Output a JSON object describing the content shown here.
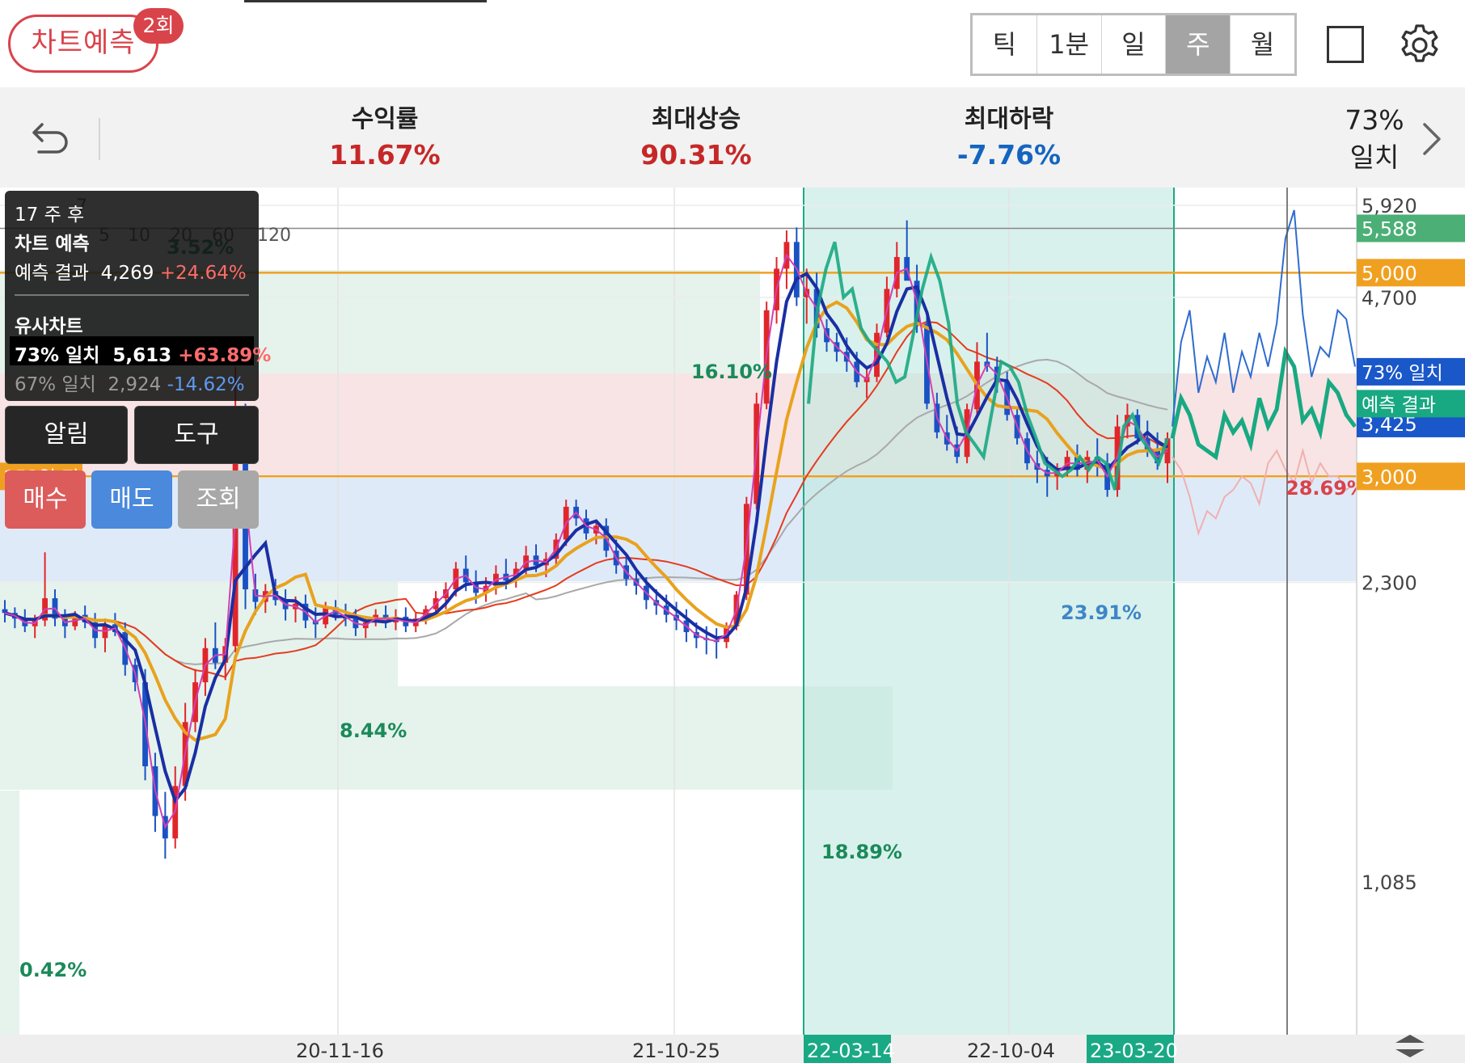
{
  "header": {
    "title_pill": "차트예측",
    "badge": "2회",
    "periods": [
      {
        "label": "틱",
        "active": false
      },
      {
        "label": "1분",
        "active": false
      },
      {
        "label": "일",
        "active": false
      },
      {
        "label": "주",
        "active": true
      },
      {
        "label": "월",
        "active": false
      }
    ]
  },
  "stats": {
    "return": {
      "label": "수익률",
      "value": "11.67%",
      "color": "#c62828"
    },
    "max_rise": {
      "label": "최대상승",
      "value": "90.31%",
      "color": "#c62828"
    },
    "max_fall": {
      "label": "최대하락",
      "value": "-7.76%",
      "color": "#1565c0"
    },
    "match_pct": "73%",
    "match_label": "일치"
  },
  "overlay": {
    "weeks_after": "17 주 후",
    "prediction_title": "차트 예측",
    "prediction_label": "예측 결과",
    "prediction_value": "4,269",
    "prediction_change": "+24.64%",
    "similar_title": "유사차트",
    "match1_label": "73% 일치",
    "match1_value": "5,613",
    "match1_change": "+63.89%",
    "match2_label": "67% 일치",
    "match2_value": "2,924",
    "match2_change": "-14.62%"
  },
  "buttons": {
    "alert": "알림",
    "tools": "도구",
    "buy": "매수",
    "sell": "매도",
    "view": "조회"
  },
  "colors": {
    "accent": "#d9434a",
    "rise": "#e0262b",
    "fall": "#1a52c4",
    "ma5": "#d33fb4",
    "ma10": "#1a2fa3",
    "ma20": "#e8a21e",
    "ma60": "#e53b1e",
    "ma120": "#a9a9a9",
    "prediction": "#19a982",
    "match_line": "#2e6cd0",
    "level_line": "#f0a020"
  },
  "chart_data": {
    "type": "candlestick",
    "period": "weekly",
    "ylim": [
      1085,
      5920
    ],
    "y_ticks": [
      "5,920",
      "4,700",
      "2,300",
      "1,085"
    ],
    "x_ticks": [
      "20-11-16",
      "21-10-25",
      "22-10-04"
    ],
    "highlight_dates": [
      "22-03-14",
      "23-03-20"
    ],
    "ma_legend": [
      "5",
      "10",
      "20",
      "60",
      "120"
    ],
    "legend_prefix": "7",
    "price_labels": [
      {
        "text": "5,588",
        "value": 5588,
        "color": "#4caf76"
      },
      {
        "text": "5,000",
        "value": 5000,
        "color": "#f0a020"
      },
      {
        "text": "3,000",
        "value": 3000,
        "color": "#f0a020"
      },
      {
        "text": "3,425",
        "value": 3425,
        "color": "#1a57c9"
      }
    ],
    "line_labels": {
      "match": "73% 일치",
      "prediction": "예측 결과",
      "days_ago": "153일 전"
    },
    "annotations": [
      "16.10%",
      "8.44%",
      "18.89%",
      "0.42%",
      "28.69%",
      "23.91%",
      "3.52%"
    ],
    "candles": [
      [
        2150,
        2200,
        2080,
        2130
      ],
      [
        2130,
        2160,
        2050,
        2100
      ],
      [
        2100,
        2150,
        2030,
        2060
      ],
      [
        2060,
        2120,
        2000,
        2090
      ],
      [
        2090,
        2480,
        2060,
        2210
      ],
      [
        2210,
        2260,
        2060,
        2100
      ],
      [
        2100,
        2150,
        2000,
        2060
      ],
      [
        2060,
        2140,
        2040,
        2120
      ],
      [
        2120,
        2170,
        2050,
        2080
      ],
      [
        2080,
        2130,
        1950,
        2000
      ],
      [
        2000,
        2100,
        1930,
        2070
      ],
      [
        2070,
        2130,
        2010,
        2030
      ],
      [
        2030,
        2080,
        1820,
        1870
      ],
      [
        1870,
        1900,
        1750,
        1790
      ],
      [
        1790,
        1850,
        1400,
        1450
      ],
      [
        1450,
        1500,
        1230,
        1280
      ],
      [
        1280,
        1360,
        1150,
        1210
      ],
      [
        1210,
        1450,
        1180,
        1380
      ],
      [
        1380,
        1700,
        1330,
        1620
      ],
      [
        1620,
        1850,
        1580,
        1790
      ],
      [
        1790,
        2000,
        1730,
        1950
      ],
      [
        1950,
        2080,
        1850,
        1880
      ],
      [
        1880,
        2000,
        1800,
        1960
      ],
      [
        1960,
        3950,
        1930,
        3450
      ],
      [
        3450,
        3600,
        2150,
        2260
      ],
      [
        2260,
        2350,
        2120,
        2190
      ],
      [
        2190,
        2290,
        2130,
        2250
      ],
      [
        2250,
        2320,
        2170,
        2200
      ],
      [
        2200,
        2260,
        2090,
        2150
      ],
      [
        2150,
        2220,
        2080,
        2180
      ],
      [
        2180,
        2230,
        2050,
        2090
      ],
      [
        2090,
        2160,
        2000,
        2070
      ],
      [
        2070,
        2190,
        2050,
        2160
      ],
      [
        2160,
        2200,
        2090,
        2120
      ],
      [
        2120,
        2180,
        2060,
        2100
      ],
      [
        2100,
        2150,
        2010,
        2050
      ],
      [
        2050,
        2110,
        2000,
        2080
      ],
      [
        2080,
        2150,
        2060,
        2120
      ],
      [
        2120,
        2170,
        2050,
        2080
      ],
      [
        2080,
        2150,
        2040,
        2110
      ],
      [
        2110,
        2160,
        2030,
        2060
      ],
      [
        2060,
        2130,
        2030,
        2100
      ],
      [
        2100,
        2170,
        2070,
        2150
      ],
      [
        2150,
        2250,
        2110,
        2210
      ],
      [
        2210,
        2300,
        2150,
        2260
      ],
      [
        2260,
        2420,
        2220,
        2380
      ],
      [
        2380,
        2460,
        2250,
        2300
      ],
      [
        2300,
        2370,
        2180,
        2240
      ],
      [
        2240,
        2330,
        2190,
        2280
      ],
      [
        2280,
        2400,
        2230,
        2350
      ],
      [
        2350,
        2440,
        2260,
        2310
      ],
      [
        2310,
        2420,
        2270,
        2380
      ],
      [
        2380,
        2520,
        2330,
        2460
      ],
      [
        2460,
        2530,
        2360,
        2400
      ],
      [
        2400,
        2480,
        2330,
        2440
      ],
      [
        2440,
        2600,
        2400,
        2560
      ],
      [
        2560,
        2830,
        2520,
        2780
      ],
      [
        2780,
        2830,
        2650,
        2700
      ],
      [
        2700,
        2760,
        2560,
        2600
      ],
      [
        2600,
        2690,
        2530,
        2650
      ],
      [
        2650,
        2700,
        2450,
        2490
      ],
      [
        2490,
        2560,
        2350,
        2400
      ],
      [
        2400,
        2450,
        2280,
        2320
      ],
      [
        2320,
        2380,
        2230,
        2280
      ],
      [
        2280,
        2330,
        2150,
        2200
      ],
      [
        2200,
        2260,
        2120,
        2170
      ],
      [
        2170,
        2230,
        2080,
        2120
      ],
      [
        2120,
        2190,
        2040,
        2090
      ],
      [
        2090,
        2150,
        1980,
        2030
      ],
      [
        2030,
        2080,
        1950,
        2000
      ],
      [
        2000,
        2060,
        1920,
        1990
      ],
      [
        1990,
        2050,
        1900,
        1980
      ],
      [
        1980,
        2080,
        1950,
        2060
      ],
      [
        2060,
        2250,
        2040,
        2230
      ],
      [
        2230,
        2850,
        2200,
        2800
      ],
      [
        2800,
        3700,
        2760,
        3600
      ],
      [
        3600,
        4650,
        3550,
        4550
      ],
      [
        4550,
        5200,
        4400,
        5050
      ],
      [
        5050,
        5560,
        4800,
        5400
      ],
      [
        5400,
        5600,
        4600,
        4700
      ],
      [
        4700,
        5050,
        4400,
        4800
      ],
      [
        4800,
        5000,
        4250,
        4350
      ],
      [
        4350,
        4450,
        4100,
        4200
      ],
      [
        4200,
        4300,
        4000,
        4100
      ],
      [
        4100,
        4250,
        3900,
        4000
      ],
      [
        4000,
        4100,
        3750,
        3800
      ],
      [
        3800,
        3950,
        3650,
        3850
      ],
      [
        3850,
        4400,
        3800,
        4300
      ],
      [
        4300,
        4950,
        4250,
        4800
      ],
      [
        4800,
        5400,
        4700,
        5200
      ],
      [
        5200,
        5700,
        4950,
        4900
      ],
      [
        4900,
        5100,
        4300,
        4400
      ],
      [
        4400,
        4500,
        3550,
        3600
      ],
      [
        3600,
        3700,
        3300,
        3350
      ],
      [
        3350,
        3500,
        3200,
        3250
      ],
      [
        3250,
        3400,
        3100,
        3150
      ],
      [
        3150,
        3600,
        3100,
        3550
      ],
      [
        3550,
        4200,
        3500,
        4000
      ],
      [
        4000,
        4300,
        3900,
        3950
      ],
      [
        3950,
        4050,
        3700,
        3800
      ],
      [
        3800,
        3900,
        3450,
        3500
      ],
      [
        3500,
        3550,
        3250,
        3300
      ],
      [
        3300,
        3350,
        3050,
        3100
      ],
      [
        3100,
        3200,
        2950,
        3050
      ],
      [
        3050,
        3150,
        2850,
        3000
      ],
      [
        3000,
        3100,
        2900,
        3050
      ],
      [
        3050,
        3200,
        3000,
        3150
      ],
      [
        3150,
        3250,
        3000,
        3050
      ],
      [
        3050,
        3200,
        2950,
        3150
      ],
      [
        3150,
        3300,
        3000,
        3100
      ],
      [
        3100,
        3180,
        2850,
        2900
      ],
      [
        2900,
        3500,
        2850,
        3400
      ],
      [
        3400,
        3600,
        3300,
        3500
      ],
      [
        3500,
        3550,
        3250,
        3300
      ],
      [
        3300,
        3450,
        3150,
        3200
      ],
      [
        3200,
        3350,
        3050,
        3100
      ],
      [
        3100,
        3350,
        2950,
        3300
      ]
    ],
    "prediction_line": [
      3300,
      3650,
      3500,
      3250,
      3200,
      3150,
      3500,
      3350,
      3450,
      3250,
      3650,
      3400,
      3550,
      4100,
      3950,
      3450,
      3550,
      3350,
      3800,
      3700,
      3500,
      3400
    ],
    "match_line": [
      3400,
      4200,
      4550,
      3700,
      4050,
      3800,
      4300,
      3700,
      4100,
      3850,
      4300,
      3950,
      4400,
      5450,
      5850,
      4500,
      3850,
      4150,
      4050,
      4550,
      4450,
      3950
    ],
    "match2_line": [
      3150,
      3050,
      2850,
      2600,
      2750,
      2700,
      2850,
      2900,
      3000,
      2950,
      2800,
      3100,
      3200,
      3050,
      2950,
      3200,
      2950,
      3100,
      3000,
      3000,
      2900,
      2950
    ]
  }
}
